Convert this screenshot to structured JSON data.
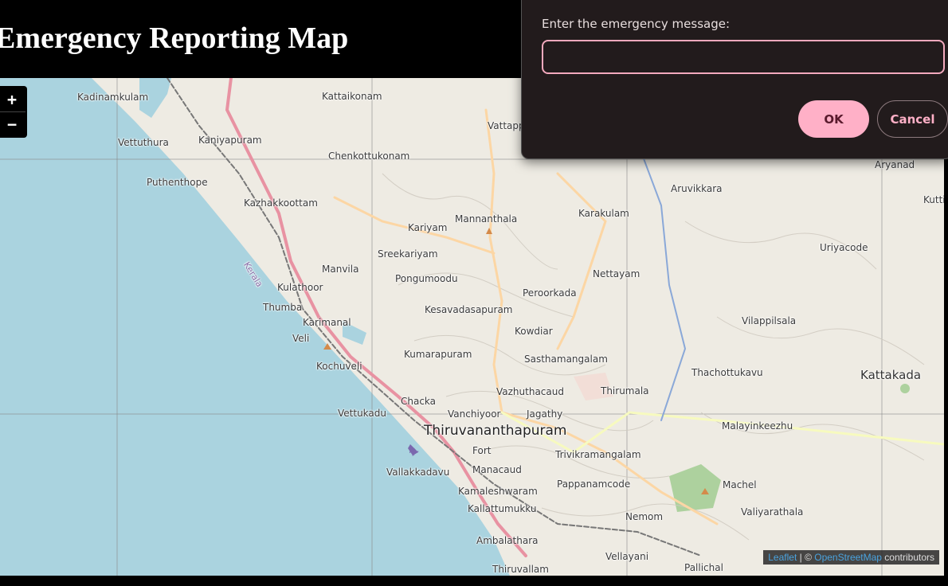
{
  "header": {
    "title": "Emergency Reporting Map"
  },
  "zoom": {
    "in_label": "+",
    "out_label": "−"
  },
  "dialog": {
    "prompt": "Enter the emergency message:",
    "input_value": "",
    "ok_label": "OK",
    "cancel_label": "Cancel"
  },
  "attribution": {
    "leaflet": "Leaflet",
    "separator": " | © ",
    "osm": "OpenStreetMap",
    "suffix": " contributors"
  },
  "map": {
    "places": [
      "Kadinamkulam",
      "Kattaikonam",
      "Vattappara",
      "Vettuthura",
      "Kaniyapuram",
      "Chenkottukonam",
      "Puthenthope",
      "Kazhakkoottam",
      "Aryanad",
      "Aruvikkara",
      "Kuttichal",
      "Karakulam",
      "Mannanthala",
      "Kariyam",
      "Sreekariyam",
      "Manvila",
      "Kerala",
      "Kulathoor",
      "Pongumoodu",
      "Nettayam",
      "Uriyacode",
      "Thumba",
      "Peroorkada",
      "Kesavadasapuram",
      "Karimanal",
      "Veli",
      "Kowdiar",
      "Vilappilsala",
      "Kumarapuram",
      "Kochuveli",
      "Sasthamangalam",
      "Thachottukavu",
      "Kattakada",
      "Vazhuthacaud",
      "Thirumala",
      "Chacka",
      "Vettukadu",
      "Vanchiyoor",
      "Jagathy",
      "Malayinkeezhu",
      "Thiruvananthapuram",
      "Fort",
      "Trivikramangalam",
      "Vallakkadavu",
      "Manacaud",
      "Pappanamcode",
      "Machel",
      "Kamaleshwaram",
      "Valiyarathala",
      "Kallattumukku",
      "Nemom",
      "Ambalathara",
      "Vellayani",
      "Pallichal",
      "Thiruvallam"
    ],
    "colors": {
      "sea": "#aad3df",
      "land": "#eeebe3",
      "motorway": "#e892a2",
      "primary": "#fcd6a4"
    }
  }
}
